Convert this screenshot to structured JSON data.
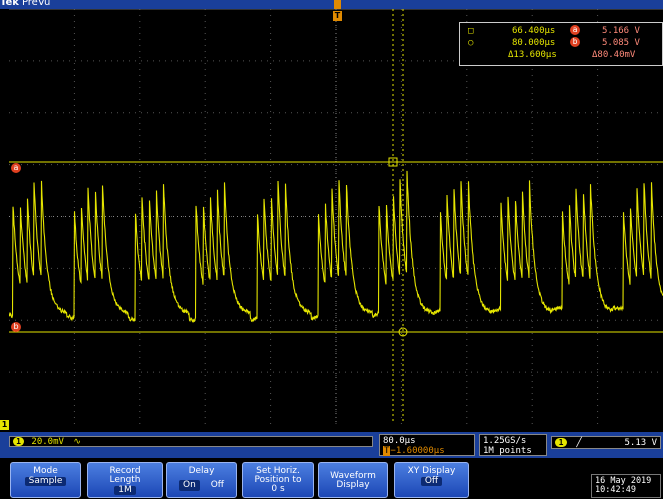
{
  "app": {
    "brand": "Tek",
    "mode": "PreVu"
  },
  "cursor_readout": {
    "cursor_a_time": "66.400µs",
    "cursor_b_time": "80.000µs",
    "delta_time": "Δ13.600µs",
    "cursor_a_voltage": "5.166 V",
    "cursor_b_voltage": "5.085 V",
    "delta_voltage": "Δ80.40mV",
    "marker_a": "a",
    "marker_b": "b"
  },
  "markers": {
    "ref_a": "a",
    "ref_b": "b",
    "trigger": "T",
    "ch1_ground": "1"
  },
  "channel": {
    "number": "1",
    "scale": "20.0mV",
    "coupling_symbol": "∿"
  },
  "horizontal": {
    "scale": "80.0µs",
    "position": "−1.60000µs",
    "trigger_marker": "T"
  },
  "acquisition": {
    "sample_rate": "1.25GS/s",
    "record": "1M points"
  },
  "trigger": {
    "source": "1",
    "slope_symbol": "╱",
    "level": "5.13 V"
  },
  "softkeys": [
    {
      "label": "Mode",
      "value": "Sample"
    },
    {
      "label": "Record Length",
      "value": "1M"
    },
    {
      "label": "Delay",
      "on": "On",
      "off": "Off"
    },
    {
      "label": "Set Horiz. Position to 0 s"
    },
    {
      "label": "Waveform Display"
    },
    {
      "label": "XY Display",
      "value": "Off"
    }
  ],
  "datetime": {
    "date": "16 May 2019",
    "time": "10:42:49"
  },
  "colors": {
    "trace": "#e5e500",
    "frame": "#1a3f9a",
    "cursor": "#e5e500",
    "button": "#2d5fd0"
  }
}
